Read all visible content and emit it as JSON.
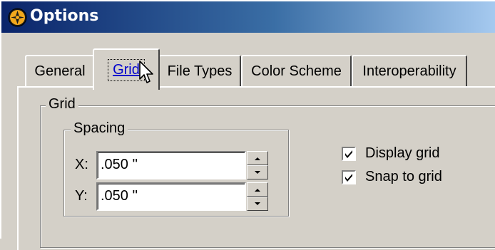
{
  "window": {
    "title": "Options",
    "icon": "app-logo-icon"
  },
  "tabs": [
    {
      "label": "General",
      "active": false
    },
    {
      "label": "Grid",
      "active": true
    },
    {
      "label": "File Types",
      "active": false
    },
    {
      "label": "Color Scheme",
      "active": false
    },
    {
      "label": "Interoperability",
      "active": false
    }
  ],
  "grid_group": {
    "title": "Grid",
    "spacing": {
      "title": "Spacing",
      "x_label": "X:",
      "x_value": ".050 ''",
      "y_label": "Y:",
      "y_value": ".050 ''"
    },
    "display_grid": {
      "label": "Display grid",
      "checked": true
    },
    "snap_to_grid": {
      "label": "Snap to grid",
      "checked": true
    }
  },
  "colors": {
    "title_bar_start": "#0a246a",
    "title_bar_end": "#a6caf0",
    "face": "#d4d0c8",
    "active_tab_text": "#0000cc"
  }
}
